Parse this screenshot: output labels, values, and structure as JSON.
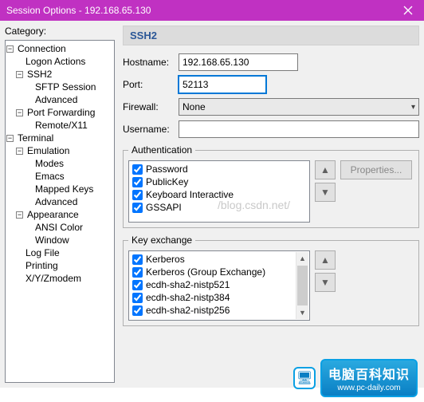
{
  "titlebar": {
    "text": "Session Options - 192.168.65.130"
  },
  "category_label": "Category:",
  "tree": {
    "connection": "Connection",
    "logon_actions": "Logon Actions",
    "ssh2": "SSH2",
    "sftp_session": "SFTP Session",
    "advanced1": "Advanced",
    "port_forwarding": "Port Forwarding",
    "remote_x11": "Remote/X11",
    "terminal": "Terminal",
    "emulation": "Emulation",
    "modes": "Modes",
    "emacs": "Emacs",
    "mapped_keys": "Mapped Keys",
    "advanced2": "Advanced",
    "appearance": "Appearance",
    "ansi_color": "ANSI Color",
    "window": "Window",
    "log_file": "Log File",
    "printing": "Printing",
    "xyzmodem": "X/Y/Zmodem"
  },
  "panel": {
    "heading": "SSH2",
    "hostname_label": "Hostname:",
    "hostname_value": "192.168.65.130",
    "port_label": "Port:",
    "port_value": "52113",
    "firewall_label": "Firewall:",
    "firewall_value": "None",
    "username_label": "Username:",
    "username_value": ""
  },
  "auth": {
    "legend": "Authentication",
    "properties_btn": "Properties...",
    "items": [
      "Password",
      "PublicKey",
      "Keyboard Interactive",
      "GSSAPI"
    ]
  },
  "kex": {
    "legend": "Key exchange",
    "items": [
      "Kerberos",
      "Kerberos (Group Exchange)",
      "ecdh-sha2-nistp521",
      "ecdh-sha2-nistp384",
      "ecdh-sha2-nistp256"
    ]
  },
  "watermark": "/blog.csdn.net/",
  "badge": {
    "title": "电脑百科知识",
    "url": "www.pc-daily.com"
  }
}
